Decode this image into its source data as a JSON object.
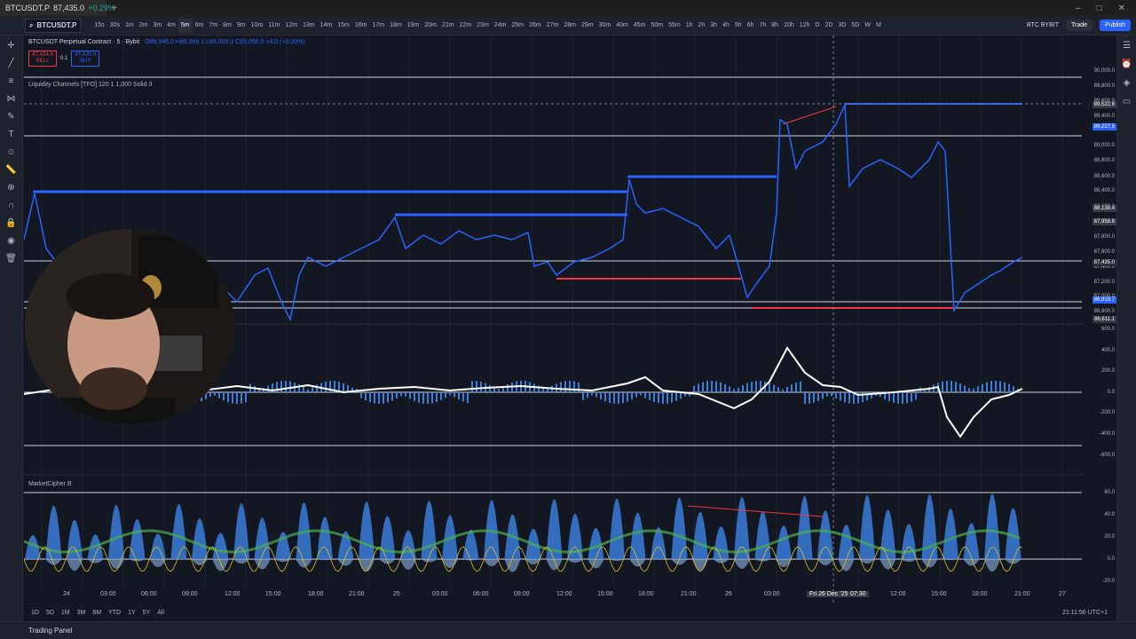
{
  "browser": {
    "tab_title": "BTCUSDT.P",
    "tab_price": "87,435.0",
    "tab_change": "+0.29%",
    "new_tab": "+",
    "win_min": "–",
    "win_max": "□",
    "win_close": "✕"
  },
  "toolbar": {
    "symbol": "BTCUSDT.P",
    "intervals": [
      "15s",
      "30s",
      "1m",
      "2m",
      "3m",
      "4m",
      "5m",
      "6m",
      "7m",
      "8m",
      "9m",
      "10m",
      "11m",
      "12m",
      "13m",
      "14m",
      "15m",
      "16m",
      "17m",
      "18m",
      "19m",
      "20m",
      "21m",
      "22m",
      "23m",
      "24m",
      "25m",
      "26m",
      "27m",
      "28m",
      "29m",
      "30m",
      "40m",
      "45m",
      "50m",
      "55m",
      "1h",
      "2h",
      "3h",
      "4h",
      "5h",
      "6h",
      "7h",
      "8h",
      "10h",
      "12h",
      "D",
      "2D",
      "3D",
      "5D",
      "W",
      "M"
    ],
    "active_interval": "5m",
    "exchange_label": "BTC BYBIT",
    "trade_label": "Trade",
    "publish_label": "Publish",
    "currency": "USDT"
  },
  "legend": {
    "title": "BTCUSDT Perpetual Contract · 5 · Bybit",
    "ohlc": "O89,046.0 H89,069.1 L89,009.3 C89,050.0 +4.0 (+0.00%)",
    "sell_price": "87,434.9",
    "sell_label": "SELL",
    "spread": "0.1",
    "buy_price": "87,435.0",
    "buy_label": "BUY",
    "liquidity_label": "Liquidity Channels [TFO] 120 1 1,000 Solid 3",
    "market_cipher_label": "MarketCipher B"
  },
  "price_axis": {
    "ticks": [
      "90,000.0",
      "89,800.0",
      "89,600.0",
      "89,400.0",
      "89,000.0",
      "88,800.0",
      "88,600.0",
      "88,400.0",
      "88,200.0",
      "87,800.0",
      "87,600.0",
      "87,400.0",
      "87,200.0",
      "87,000.0",
      "86,800.0"
    ],
    "tags": [
      {
        "label": "89,522.6",
        "color": "#363a45"
      },
      {
        "label": "89,227.5",
        "color": "#2962ff"
      },
      {
        "label": "88,138.4",
        "color": "#363a45"
      },
      {
        "label": "87,958.8",
        "color": "#363a45"
      },
      {
        "label": "87,435.0",
        "color": "#2a2e39"
      },
      {
        "label": "86,919.7",
        "color": "#2962ff"
      },
      {
        "label": "86,611.1",
        "color": "#363a45"
      }
    ],
    "osc_ticks": [
      "600.0",
      "400.0",
      "200.0",
      "0.0",
      "-200.0",
      "-400.0",
      "-600.0"
    ],
    "mc_ticks": [
      "60.0",
      "40.0",
      "20.0",
      "0.0",
      "-20.0"
    ]
  },
  "time_axis": {
    "labels": [
      "24",
      "03:00",
      "06:00",
      "09:00",
      "12:00",
      "15:00",
      "18:00",
      "21:00",
      "25",
      "03:00",
      "06:00",
      "09:00",
      "12:00",
      "15:00",
      "18:00",
      "21:00",
      "26",
      "03:00",
      "Fri 26 Dec '25",
      "07:30",
      "12:00",
      "15:00",
      "18:00",
      "21:00",
      "27"
    ]
  },
  "bottom": {
    "ranges": [
      "1D",
      "5D",
      "1M",
      "3M",
      "6M",
      "YTD",
      "1Y",
      "5Y",
      "All"
    ],
    "clock": "21:11:56 UTC+1",
    "panel_label": "Trading Panel"
  },
  "colors": {
    "bg": "#131722",
    "price_line": "#2962ff",
    "liquidity_high": "#2962ff",
    "liquidity_low": "#f23645",
    "osc_line": "#ffffff",
    "mc_blue": "#3b7dd8",
    "mc_green": "#4caf50",
    "mc_yellow": "#d4c22a"
  },
  "icons": [
    "cursor-icon",
    "trendline-icon",
    "fib-icon",
    "brush-icon",
    "text-icon",
    "emoji-icon",
    "ruler-icon",
    "zoom-icon",
    "magnet-icon",
    "lock-icon",
    "eye-icon",
    "trash-icon"
  ]
}
